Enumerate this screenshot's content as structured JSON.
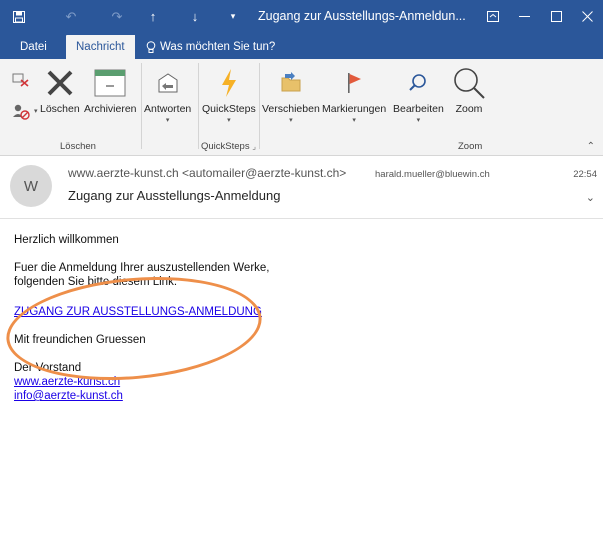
{
  "titlebar": {
    "title": "Zugang zur Ausstellungs-Anmeldun...",
    "save_icon": "save-icon",
    "undo_icon": "undo-icon",
    "redo_icon": "redo-icon",
    "up_icon": "arrow-up-icon",
    "down_icon": "arrow-down-icon",
    "more_icon": "customize-toolbar-icon"
  },
  "tabs": [
    {
      "label": "Datei"
    },
    {
      "label": "Nachricht"
    }
  ],
  "tell_me": {
    "label": "Was möchten Sie tun?"
  },
  "ribbon": {
    "loeschen_group": {
      "label": "Löschen",
      "buttons": [
        {
          "label": "Löschen"
        },
        {
          "label": "Archivieren"
        }
      ]
    },
    "antworten": {
      "label": "Antworten"
    },
    "quicksteps_group": {
      "label": "QuickSteps",
      "buttons": [
        {
          "label": "QuickSteps"
        }
      ]
    },
    "verschieben": {
      "label": "Verschieben"
    },
    "markierungen": {
      "label": "Markierungen"
    },
    "bearbeiten": {
      "label": "Bearbeiten"
    },
    "zoom_group": {
      "label": "Zoom",
      "buttons": [
        {
          "label": "Zoom"
        }
      ]
    }
  },
  "message": {
    "avatar_initial": "W",
    "from": "www.aerzte-kunst.ch <automailer@aerzte-kunst.ch>",
    "to": "harald.mueller@bluewin.ch",
    "time": "22:54",
    "subject": "Zugang zur Ausstellungs-Anmeldung"
  },
  "body": {
    "greeting": "Herzlich willkommen",
    "line1": "Fuer die Anmeldung Ihrer auszustellenden Werke,",
    "line2": "folgenden Sie bitte diesem Link:",
    "link": "ZUGANG ZUR AUSSTELLUNGS-ANMELDUNG",
    "closing": "Mit freundichen Gruessen",
    "signature": "Der Vorstand",
    "website": "www.aerzte-kunst.ch",
    "email": "info@aerzte-kunst.ch"
  },
  "colors": {
    "accent": "#2b579a",
    "link": "#1a00e6",
    "annotation": "#ee8f4a"
  }
}
